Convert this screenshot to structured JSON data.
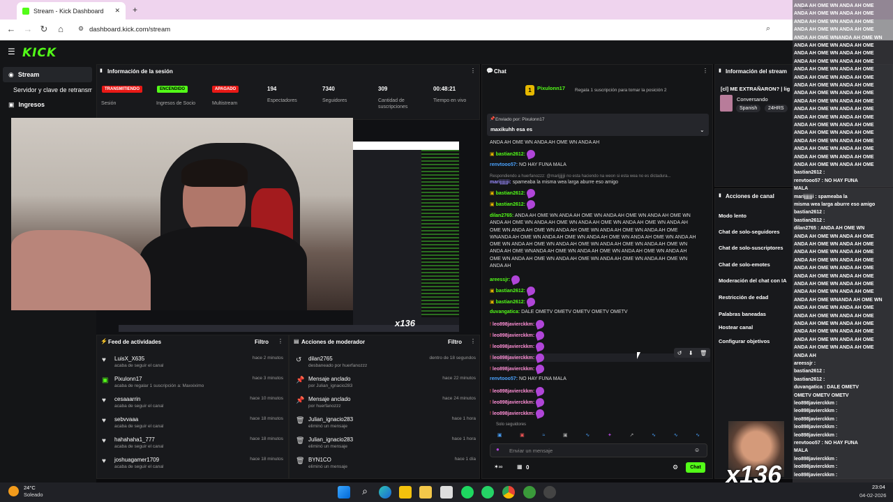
{
  "browser": {
    "tab_title": "Stream - Kick Dashboard",
    "url": "dashboard.kick.com/stream"
  },
  "nav": {
    "logo": "KICK"
  },
  "sidebar": {
    "items": [
      {
        "label": "Stream"
      },
      {
        "label": "Servidor y clave de retransm"
      },
      {
        "label": "Ingresos"
      }
    ]
  },
  "session": {
    "title": "Información de la sesión",
    "badges": [
      {
        "text": "TRANSMITIENDO",
        "label": "Sesión",
        "color": "#e91916"
      },
      {
        "text": "ENCENDIDO",
        "label": "Ingresos de Socio",
        "color": "#53fc18"
      },
      {
        "text": "APAGADO",
        "label": "Multistream",
        "color": "#e91916"
      }
    ],
    "stats": [
      {
        "value": "194",
        "label": "Espectadores"
      },
      {
        "value": "7340",
        "label": "Seguidores"
      },
      {
        "value": "309",
        "label": "Cantidad de suscripciones"
      },
      {
        "value": "00:48:21",
        "label": "Tiempo en vivo"
      }
    ]
  },
  "feed": {
    "title": "Feed de actividades",
    "filter": "Filtro",
    "rows": [
      {
        "name": "LuisX_X635",
        "sub": "acaba de seguir el canal",
        "time": "hace 2 minutos"
      },
      {
        "name": "Pixulonn17",
        "sub": "acaba de regalar 1 suscripción a: Maxxiximo",
        "time": "hace 3 minutos"
      },
      {
        "name": "cesaaarrin",
        "sub": "acaba de seguir el canal",
        "time": "hace 10 minutos"
      },
      {
        "name": "sebvvaaa",
        "sub": "acaba de seguir el canal",
        "time": "hace 18 minutos"
      },
      {
        "name": "hahahaha1_777",
        "sub": "acaba de seguir el canal",
        "time": "hace 18 minutos"
      },
      {
        "name": "joshuagamer1709",
        "sub": "acaba de seguir el canal",
        "time": "hace 18 minutos"
      }
    ]
  },
  "modactions": {
    "title": "Acciones de moderador",
    "filter": "Filtro",
    "rows": [
      {
        "name": "dilan2765",
        "sub": "desbaneado por huerfanozzz",
        "time": "dentro de 18 segundos"
      },
      {
        "name": "Mensaje anclado",
        "sub": "por Julian_ignacio283",
        "time": "hace 22 minutos"
      },
      {
        "name": "Mensaje anclado",
        "sub": "por huerfanozzz",
        "time": "hace 24 minutos"
      },
      {
        "name": "Julian_ignacio283",
        "sub": "eliminó un mensaje",
        "time": "hace 1 hora"
      },
      {
        "name": "Julian_ignacio283",
        "sub": "eliminó un mensaje",
        "time": "hace 1 hora"
      },
      {
        "name": "BYN1CO",
        "sub": "eliminó un mensaje",
        "time": "hace 1 día"
      }
    ]
  },
  "chat": {
    "title": "Chat",
    "gift_user": "Pixulonn17",
    "gift_text": "Regala 1 suscripción para tomar la posición 2",
    "pinned_by": "Enviado por: Pixulonn17",
    "pinned_text": "maxikuhh esa es",
    "input_placeholder": "Enviar un mensaje",
    "send": "Chat",
    "footer_count": "0",
    "sub_only": "Solo seguidores",
    "lines": [
      {
        "user": "",
        "text": "ANDA AH OME WN ANDA AH OME WN ANDA AH"
      },
      {
        "user": "bastian2612:",
        "text": "",
        "color": "#53fc18"
      },
      {
        "user": "renvtooo57:",
        "text": "NO HAY FUNA MALA",
        "color": "#4aa3ff"
      },
      {
        "user": "",
        "text": "Respondiendo a huerfanozzz: @marijjjjjji no esta haciendo na weon si esta wea no es dictadura..."
      },
      {
        "user": "marijjjjjji:",
        "text": "spameaba la misma wea larga aburre eso amigo",
        "color": "#9b8cff"
      },
      {
        "user": "bastian2612:",
        "text": "",
        "color": "#53fc18"
      },
      {
        "user": "bastian2612:",
        "text": "",
        "color": "#53fc18"
      },
      {
        "user": "dilan2765:",
        "text": "ANDA AH OME WN ANDA AH OME WN ANDA AH OME WN ANDA AH OME WN ANDA AH OME WN ANDA AH OME WN ANDA AH OME WN ANDA AH OME WN ANDA AH OME WN ANDA AH OME WN ANDA AH OME WN ANDA AH OME WN ANDA AH OME WNANDA AH OME WN ANDA AH OME WN ANDA AH OME WN ANDA AH OME WN ANDA AH OME WN ANDA AH OME WN ANDA AH OME WN ANDA AH OME WN ANDA AH OME WN ANDA AH OME WNANDA AH OME WN ANDA AH OME WN ANDA AH OME WN ANDA AH OME WN ANDA AH OME WN ANDA AH OME WN ANDA AH OME WN ANDA AH OME WN ANDA AH",
        "color": "#53fc18"
      },
      {
        "user": "areessjr:",
        "text": "",
        "color": "#53fc18"
      },
      {
        "user": "bastian2612:",
        "text": "",
        "color": "#53fc18"
      },
      {
        "user": "bastian2612:",
        "text": "",
        "color": "#53fc18"
      },
      {
        "user": "duvangatica:",
        "text": "DALE OMETV OMETV OMETV OMETV OMETV",
        "color": "#53fc18"
      },
      {
        "user": "leo898javierckkm:",
        "text": "",
        "color": "#ff8fd6"
      },
      {
        "user": "leo898javierckkm:",
        "text": "",
        "color": "#ff8fd6"
      },
      {
        "user": "leo898javierckkm:",
        "text": "",
        "color": "#ff8fd6"
      },
      {
        "user": "leo898javierckkm:",
        "text": "",
        "color": "#ff8fd6"
      },
      {
        "user": "leo898javierckkm:",
        "text": "",
        "color": "#ff8fd6"
      },
      {
        "user": "renvtooo57:",
        "text": "NO HAY FUNA MALA",
        "color": "#4aa3ff"
      },
      {
        "user": "leo898javierckkm:",
        "text": "",
        "color": "#ff8fd6"
      },
      {
        "user": "leo898javierckkm:",
        "text": "",
        "color": "#ff8fd6"
      },
      {
        "user": "leo898javierckkm:",
        "text": "",
        "color": "#ff8fd6"
      }
    ]
  },
  "streaminfo": {
    "title": "Información del stream",
    "stream_title": "[cl] ME EXTRAÑARON? | lig",
    "category": "Conversando",
    "tags": [
      "Spanish",
      "24HRS"
    ]
  },
  "channel_actions": {
    "title": "Acciones de canal",
    "items": [
      "Modo lento",
      "Chat de solo-seguidores",
      "Chat de solo-suscriptores",
      "Chat de solo-emotes",
      "Moderación del chat con IA",
      "Restricción de edad",
      "Palabras baneadas",
      "Hostear canal",
      "Configurar objetivos"
    ]
  },
  "overlay": {
    "x136": "x136",
    "rf_lines": [
      "ANDA AH OME WN ANDA AH OME",
      "ANDA AH OME WN ANDA AH OME",
      "ANDA AH OME WN ANDA AH OME",
      "ANDA AH OME WN ANDA AH OME",
      "ANDA AH OME WNANDA AH OME WN",
      "ANDA AH OME WN ANDA AH OME",
      "ANDA AH OME WN ANDA AH OME",
      "ANDA AH OME WN ANDA AH OME",
      "ANDA AH OME WN ANDA AH OME",
      "ANDA AH OME WN ANDA AH OME",
      "ANDA AH OME WN ANDA AH OME",
      "ANDA AH OME WN ANDA AH OME",
      "ANDA AH OME WN ANDA AH OME",
      "ANDA AH OME WN ANDA AH OME",
      "ANDA AH OME WN ANDA AH OME",
      "ANDA AH OME WN ANDA AH OME",
      "ANDA AH OME WN ANDA AH OME",
      "ANDA AH OME WN ANDA AH OME",
      "ANDA AH OME WN ANDA AH OME",
      "ANDA AH OME WN ANDA AH OME",
      "ANDA AH OME WN ANDA AH OME",
      "bastian2612 :",
      "renvtooo57 : NO HAY FUNA",
      "MALA",
      "marijjjjjji : spameaba la",
      "misma wea larga aburre eso amigo",
      "bastian2612 :",
      "bastian2612 :",
      "dilan2765 : ANDA AH OME WN",
      "ANDA AH OME WN ANDA AH OME",
      "ANDA AH OME WN ANDA AH OME",
      "ANDA AH OME WN ANDA AH OME",
      "ANDA AH OME WN ANDA AH OME",
      "ANDA AH OME WN ANDA AH OME",
      "ANDA AH OME WN ANDA AH OME",
      "ANDA AH OME WN ANDA AH OME",
      "ANDA AH OME WN ANDA AH OME",
      "ANDA AH OME WNANDA AH OME WN",
      "ANDA AH OME WN ANDA AH OME",
      "ANDA AH OME WN ANDA AH OME",
      "ANDA AH OME WN ANDA AH OME",
      "ANDA AH OME WN ANDA AH OME",
      "ANDA AH OME WN ANDA AH OME",
      "ANDA AH OME WN ANDA AH OME",
      "ANDA AH",
      "areessjr :",
      "bastian2612 :",
      "bastian2612 :",
      "duvangatica : DALE OMETV",
      "OMETV OMETV OMETV",
      "leo898javierckkm :",
      "leo898javierckkm :",
      "leo898javierckkm :",
      "leo898javierckkm :",
      "leo898javierckkm :",
      "renvtooo57 : NO HAY FUNA",
      "MALA",
      "leo898javierckkm :",
      "leo898javierckkm :",
      "leo898javierckkm :"
    ]
  },
  "weather": {
    "temp": "24°C",
    "desc": "Soleado"
  },
  "clock": {
    "time": "23:04",
    "date": "04-02-2026"
  }
}
